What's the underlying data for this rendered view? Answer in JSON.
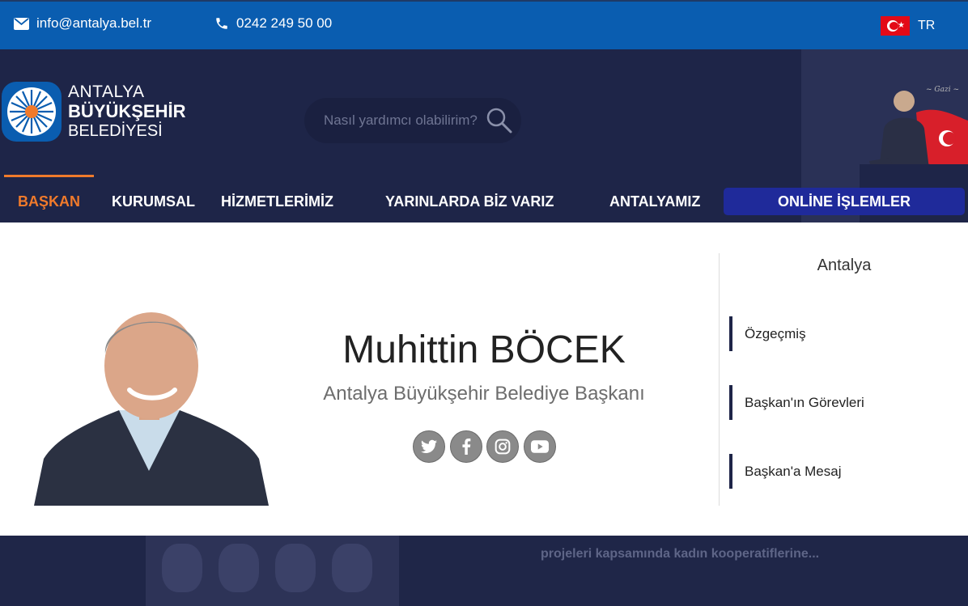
{
  "topbar": {
    "email": "info@antalya.bel.tr",
    "phone": "0242 249 50 00",
    "language": "TR"
  },
  "logo": {
    "line1": "ANTALYA",
    "line2": "BÜYÜKŞEHİR",
    "line3": "BELEDİYESİ"
  },
  "search": {
    "placeholder": "Nasıl yardımcı olabilirim?"
  },
  "nav": {
    "items": [
      "BAŞKAN",
      "KURUMSAL",
      "HİZMETLERİMİZ",
      "YARINLARDA BİZ VARIZ",
      "ANTALYAMIZ"
    ],
    "online": "ONLİNE İŞLEMLER",
    "active_index": 0
  },
  "mayor": {
    "name": "Muhittin BÖCEK",
    "title": "Antalya Büyükşehir Belediye Başkanı",
    "socials": [
      "twitter-icon",
      "facebook-icon",
      "instagram-icon",
      "youtube-icon"
    ]
  },
  "sidebar": {
    "title": "Antalya",
    "links": [
      "Özgeçmiş",
      "Başkan'ın Görevleri",
      "Başkan'a Mesaj"
    ]
  },
  "news": {
    "caption": "projeleri kapsamında kadın kooperatiflerine..."
  },
  "colors": {
    "topbar": "#0a5db0",
    "header": "#1e2548",
    "accent": "#f07a2b",
    "online_button": "#1f2a9a"
  }
}
